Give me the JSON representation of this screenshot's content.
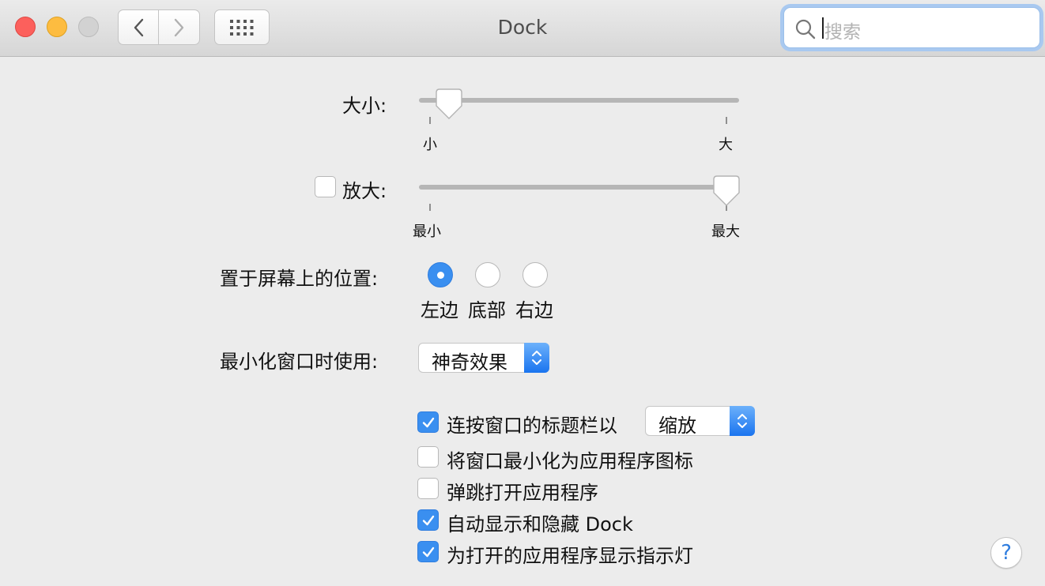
{
  "window": {
    "title": "Dock"
  },
  "search": {
    "placeholder": "搜索",
    "value": ""
  },
  "size": {
    "label": "大小:",
    "min_label": "小",
    "max_label": "大",
    "value_fraction": 0.09
  },
  "magnification": {
    "checked": false,
    "label": "放大:",
    "min_label": "最小",
    "max_label": "最大",
    "value_fraction": 0.97
  },
  "position": {
    "label": "置于屏幕上的位置:",
    "options": [
      "左边",
      "底部",
      "右边"
    ],
    "selected": "左边"
  },
  "minimize": {
    "label": "最小化窗口时使用:",
    "value": "神奇效果"
  },
  "titlebar_double_click": {
    "checked": true,
    "label": "连按窗口的标题栏以",
    "value": "缩放"
  },
  "options": [
    {
      "label": "将窗口最小化为应用程序图标",
      "checked": false
    },
    {
      "label": "弹跳打开应用程序",
      "checked": false
    },
    {
      "label": "自动显示和隐藏 Dock",
      "checked": true
    },
    {
      "label": "为打开的应用程序显示指示灯",
      "checked": true
    }
  ],
  "help": {
    "label": "?"
  },
  "colors": {
    "accent": "#3a8ff0",
    "close": "#fc605c",
    "minimize": "#fdbc40",
    "zoom_disabled": "#d2d2d2"
  },
  "icons": [
    "chevron-left-icon",
    "chevron-right-icon",
    "grid-icon",
    "search-icon",
    "checkmark-icon",
    "updown-arrows-icon",
    "slider-thumb-icon"
  ]
}
